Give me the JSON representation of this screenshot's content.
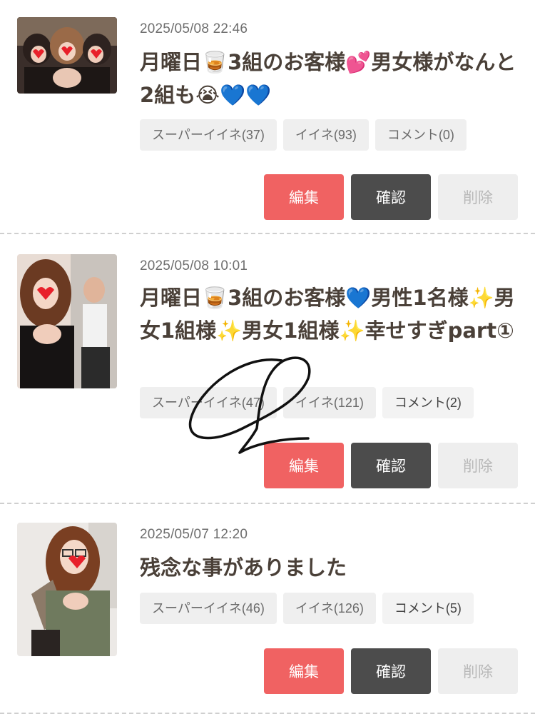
{
  "posts": [
    {
      "date": "2025/05/08 22:46",
      "title": "月曜日🥃3組のお客様💕男女様がなんと2組も😭💙💙",
      "tags": [
        "スーパーイイネ(37)",
        "イイネ(93)",
        "コメント(0)"
      ],
      "buttons": {
        "edit": "編集",
        "confirm": "確認",
        "delete": "削除"
      }
    },
    {
      "date": "2025/05/08 10:01",
      "title": "月曜日🥃3組のお客様💙男性1名様✨男女1組様✨男女1組様✨幸せすぎpart①",
      "tags": [
        "スーパーイイネ(47)",
        "イイネ(121)",
        "コメント(2)"
      ],
      "buttons": {
        "edit": "編集",
        "confirm": "確認",
        "delete": "削除"
      }
    },
    {
      "date": "2025/05/07 12:20",
      "title": "残念な事がありました",
      "tags": [
        "スーパーイイネ(46)",
        "イイネ(126)",
        "コメント(5)"
      ],
      "buttons": {
        "edit": "編集",
        "confirm": "確認",
        "delete": "削除"
      }
    }
  ],
  "colors": {
    "edit_button": "#f06262",
    "confirm_button": "#4c4c4c",
    "delete_button": "#eeeeee",
    "tag_background": "#efefef",
    "title_text": "#4a4038",
    "divider": "#cfcfcf"
  }
}
